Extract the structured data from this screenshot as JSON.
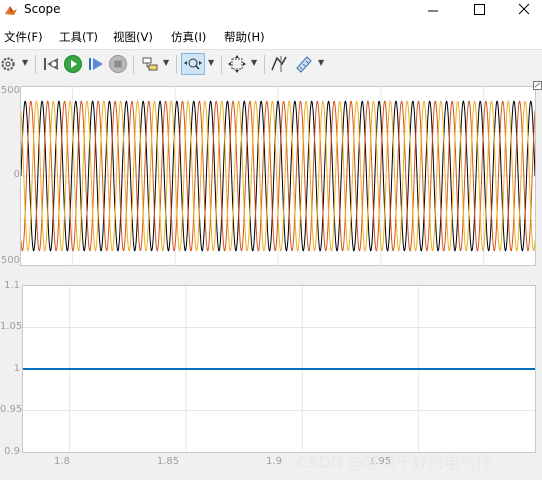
{
  "window": {
    "title": "Scope"
  },
  "menu": [
    {
      "label": "文件(F)"
    },
    {
      "label": "工具(T)"
    },
    {
      "label": "视图(V)"
    },
    {
      "label": "仿真(I)"
    },
    {
      "label": "帮助(H)"
    }
  ],
  "toolbar": {
    "icons": [
      "settings-icon",
      "restore-icon",
      "run-icon",
      "step-forward-icon",
      "stop-icon",
      "highlight-block-icon",
      "zoom-icon",
      "autoscale-icon",
      "data-cursor-icon",
      "measurement-icon"
    ]
  },
  "colors": {
    "accent": "#0078d7",
    "series_black": "#000000",
    "series_red": "#d9541a",
    "series_yellow": "#edb120",
    "series_blue": "#0072bd"
  },
  "plot1": {
    "yticks": [
      "500",
      "0",
      "500"
    ],
    "chart_data": {
      "type": "line",
      "series": [
        {
          "color": "#000000",
          "amplitude": 420,
          "phase_deg": 0
        },
        {
          "color": "#d9541a",
          "amplitude": 420,
          "phase_deg": -120
        },
        {
          "color": "#edb120",
          "amplitude": 420,
          "phase_deg": 120
        }
      ],
      "ylim": [
        -500,
        500
      ],
      "cycles": 30.5,
      "grid": true
    }
  },
  "plot2": {
    "yticks": [
      "1.1",
      "1.05",
      "1",
      "0.95",
      "0.9"
    ],
    "xticks": [
      "1.8",
      "1.85",
      "1.9",
      "1.95"
    ],
    "chart_data": {
      "type": "line",
      "series": [
        {
          "color": "#0072bd",
          "x": [
            1.78,
            2.0
          ],
          "y": [
            1,
            1
          ]
        }
      ],
      "ylim": [
        0.9,
        1.1
      ],
      "xlim": [
        1.78,
        2.0
      ],
      "grid": true
    }
  },
  "watermark": "CSDN @学习不好的电气仔"
}
